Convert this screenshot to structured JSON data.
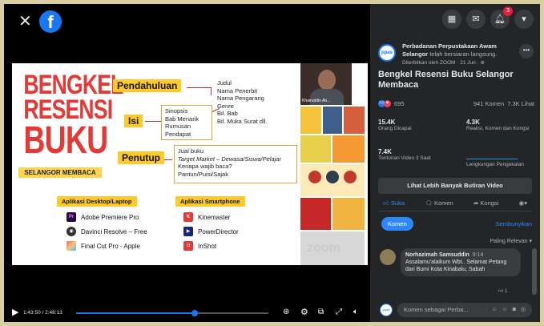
{
  "player": {
    "current_time": "1:43:50",
    "duration": "2:48:13",
    "progress": 0.617
  },
  "slide": {
    "title_lines": [
      "BENGKEL",
      "RESENSI",
      "BUKU"
    ],
    "subtitle": "SELANGOR MEMBACA",
    "sections": [
      {
        "tag": "Pendahuluan",
        "items": [
          "Judul",
          "Nama Penerbit",
          "Nama Pengarang",
          "Genre",
          "Bil. Bab",
          "Bil. Muka Surat dll."
        ]
      },
      {
        "tag": "Isi",
        "items": [
          "Sinopsis",
          "Bab Menarik",
          "Rumusan",
          "Pendapat"
        ]
      },
      {
        "tag": "Penutup",
        "items": [
          "Jual buku",
          "Target Market – Dewasa/Siswa/Pelajar",
          "Kenapa wajib baca?",
          "Pantun/Puisi/Sajak"
        ]
      }
    ],
    "desktop_heading": "Aplikasi Desktop/Laptop",
    "desktop_apps": [
      "Adobe Premiere Pro",
      "Davinci Resolve – Free",
      "Final Cut Pro - Apple"
    ],
    "phone_heading": "Aplikasi Smartphone",
    "phone_apps": [
      "Kinemaster",
      "PowerDirector",
      "InShot"
    ],
    "cam_name": "Khairuddin Ab...",
    "watermark": "zoom"
  },
  "header": {
    "notification_count": "3",
    "icons": [
      "apps-grid-icon",
      "messenger-icon",
      "bell-icon",
      "caret-down-icon"
    ]
  },
  "post": {
    "page_name": "Perbadanan Perpustakaan Awam Selangor",
    "live_text": "telah bersiaran langsung.",
    "meta": "Diterbitkan oleh ZOOM · 21 Jun ·",
    "title": "Bengkel Resensi Buku Selangor Membaca",
    "reactions": "695",
    "comments_count": "941 Komen",
    "views": "7.3K Lihat",
    "stats": {
      "reach_value": "15.4K",
      "reach_label": "Orang Dicapai",
      "engage_value": "4.3K",
      "engage_label": "Reaksi, Komen dan Kongsi",
      "views3s_value": "7.4K",
      "views3s_label": "Tontonan Video 3 Saat",
      "retention_label": "Lengkungan Pengekalan"
    },
    "more_videos": "Lihat Lebih Banyak Butiran Video",
    "like": "Suka",
    "comment": "Komen",
    "share": "Kongsi"
  },
  "comments": {
    "tab": "Komen",
    "hide": "Sembunyikan",
    "sort": "Paling Relevan",
    "items": [
      {
        "author": "Norhazimah Samsuddin",
        "time": "9:14",
        "text": "Assalamu'alaikum Wbt.. Selamat Petang dari Bumi Kota Kinabalu, Sabah",
        "likes": "1"
      }
    ],
    "placeholder": "Komen sebagai Perba..."
  }
}
